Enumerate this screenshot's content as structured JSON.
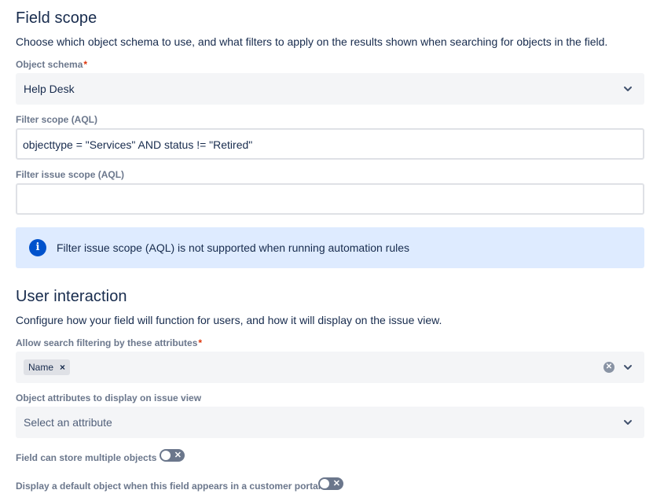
{
  "field_scope": {
    "title": "Field scope",
    "description": "Choose which object schema to use, and what filters to apply on the results shown when searching for objects in the field.",
    "object_schema": {
      "label": "Object schema",
      "required_mark": "*",
      "value": "Help Desk"
    },
    "filter_scope": {
      "label": "Filter scope (AQL)",
      "value": "objecttype = \"Services\" AND status != \"Retired\""
    },
    "filter_issue_scope": {
      "label": "Filter issue scope (AQL)",
      "value": ""
    },
    "info": {
      "icon": "info-icon",
      "text": "Filter issue scope (AQL) is not supported when running automation rules"
    }
  },
  "user_interaction": {
    "title": "User interaction",
    "description": "Configure how your field will function for users, and how it will display on the issue view.",
    "search_filtering": {
      "label": "Allow search filtering by these attributes",
      "required_mark": "*",
      "tags": [
        "Name"
      ],
      "tag_remove": "×"
    },
    "display_attributes": {
      "label": "Object attributes to display on issue view",
      "placeholder": "Select an attribute"
    },
    "multiple_objects": {
      "label": "Field can store multiple objects",
      "toggle_glyph": "✕",
      "enabled": false
    },
    "default_object": {
      "label": "Display a default object when this field appears in a customer portal",
      "toggle_glyph": "✕",
      "enabled": false
    }
  },
  "colors": {
    "info_bg": "#deebff",
    "info_icon": "#0052cc",
    "required": "#de350b",
    "toggle_off": "#6b778c"
  }
}
